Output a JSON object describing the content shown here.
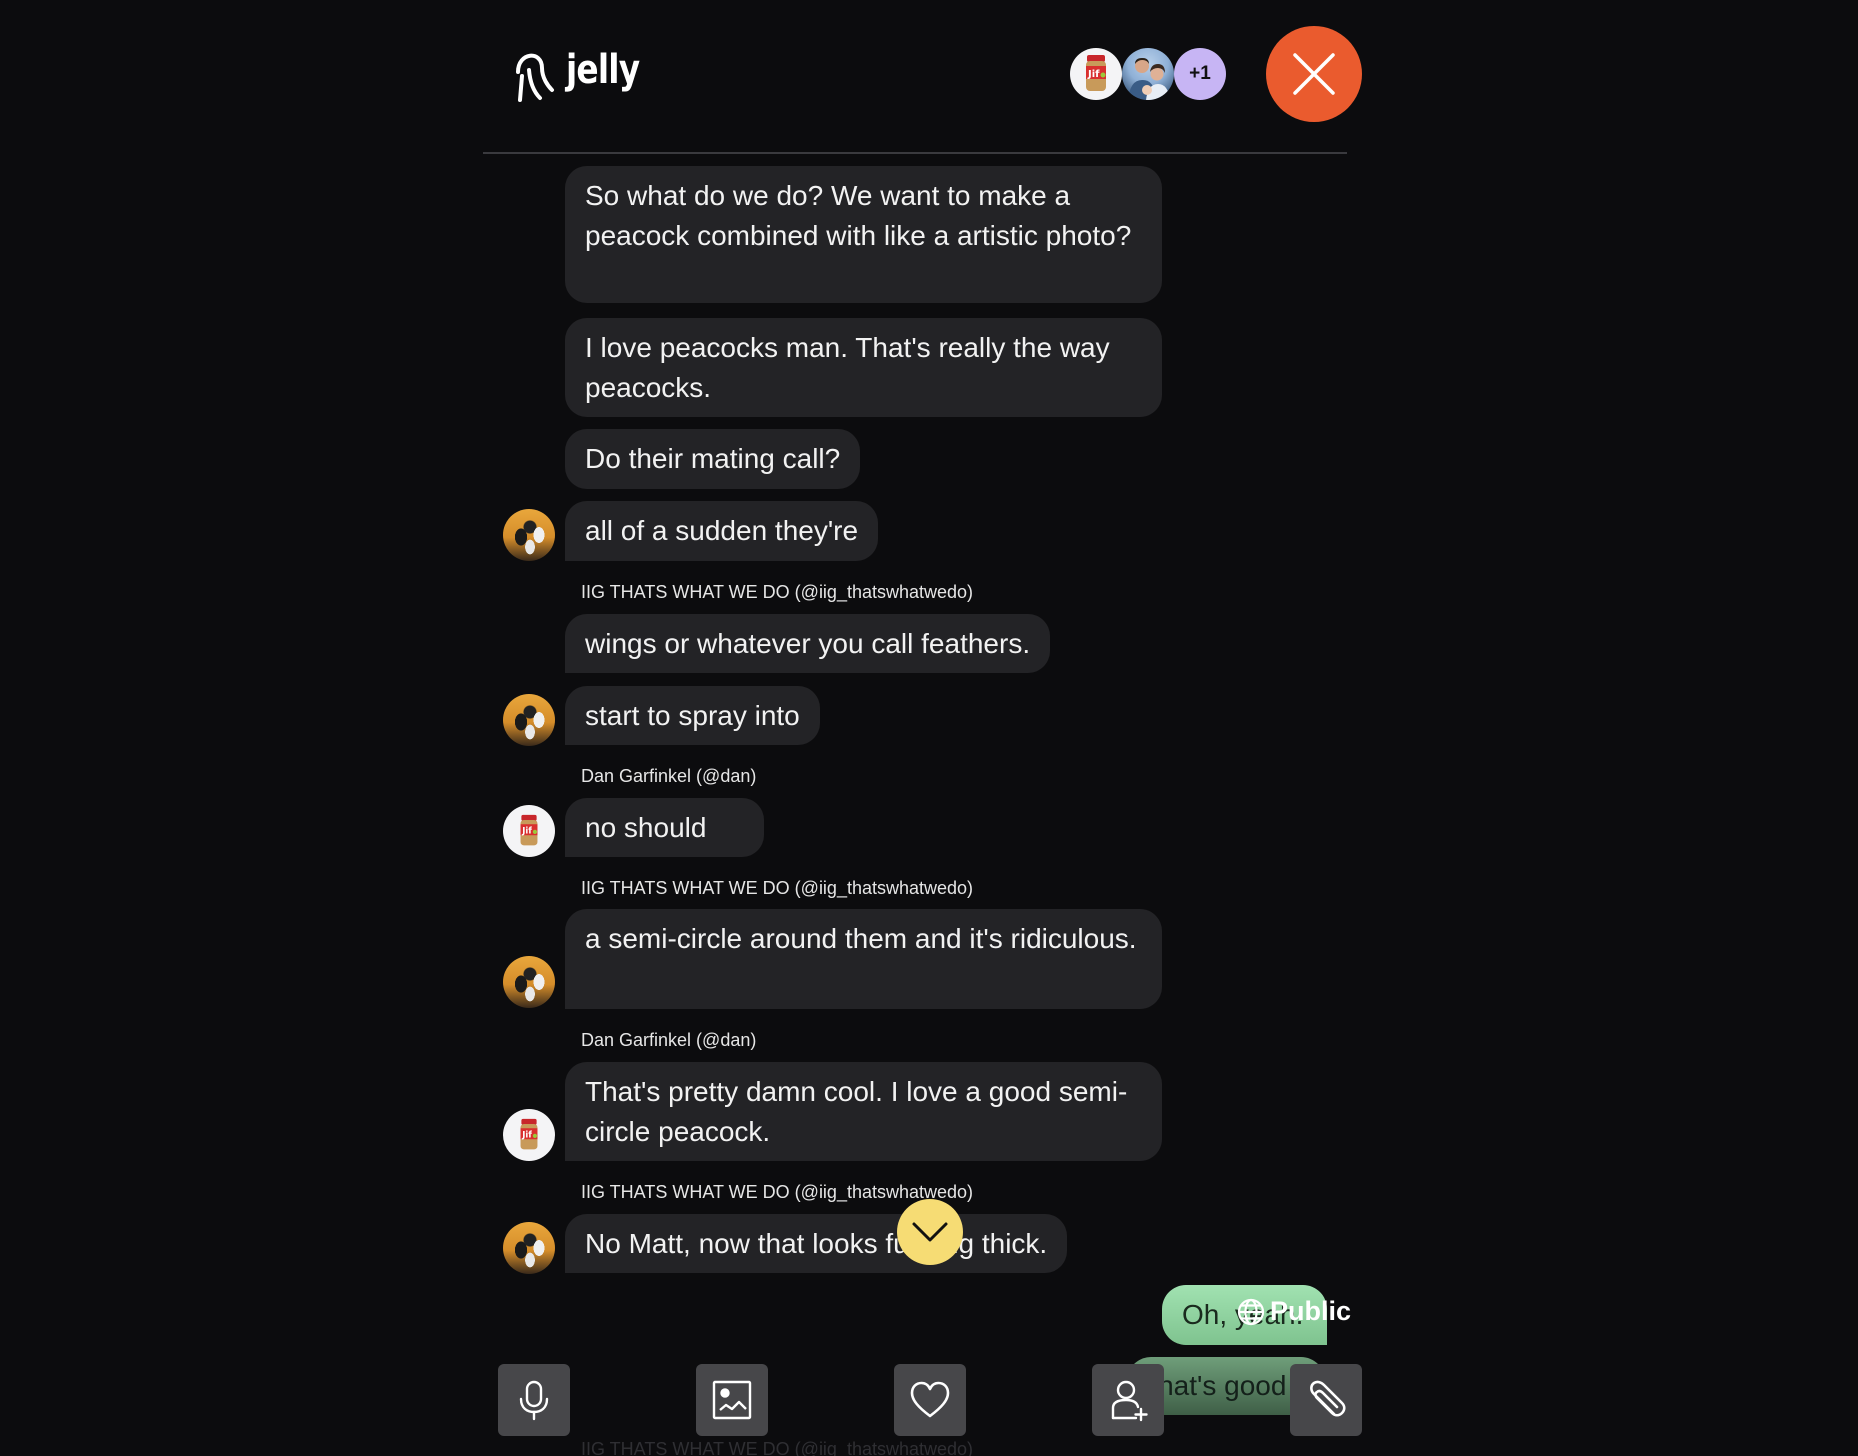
{
  "app": {
    "name": "jelly",
    "logo_icon": "jellyfish-icon"
  },
  "header": {
    "participants": [
      {
        "name": "Dan Garfinkel",
        "avatar": "jif-jar-avatar"
      },
      {
        "name": "family-photo",
        "avatar": "family-photo-avatar"
      }
    ],
    "more_count": "+1",
    "close_icon": "close-icon",
    "close_color": "#ea5b2e"
  },
  "messages": [
    {
      "text": "So what do we do? We want to make a peacock combined with like a artistic photo?"
    },
    {
      "text": "I love peacocks man. That's really the way peacocks."
    },
    {
      "text": "Do their mating call?"
    },
    {
      "text": "all of a sudden they're"
    },
    {
      "sender": "IIG THATS WHAT WE DO (@iig_thatswhatwedo)",
      "text": "wings or whatever you call feathers."
    },
    {
      "text": "start to spray into"
    },
    {
      "sender": "Dan Garfinkel (@dan)",
      "text": "no should"
    },
    {
      "sender": "IIG THATS WHAT WE DO (@iig_thatswhatwedo)",
      "text": "a semi-circle around them and it's ridiculous."
    },
    {
      "sender": "Dan Garfinkel (@dan)",
      "text": "That's pretty damn cool. I love a good semi-circle peacock."
    },
    {
      "sender": "IIG THATS WHAT WE DO (@iig_thatswhatwedo)",
      "text": "No Matt, now that looks fucking thick."
    }
  ],
  "outgoing": [
    {
      "text": "Oh, yeah."
    },
    {
      "text": "That's good"
    }
  ],
  "visibility": {
    "label": "Public",
    "icon": "globe-icon"
  },
  "scroll_down_color": "#f6dc74",
  "toolbar": {
    "buttons": [
      {
        "name": "microphone",
        "icon": "microphone-icon"
      },
      {
        "name": "image",
        "icon": "image-icon"
      },
      {
        "name": "heart",
        "icon": "heart-icon"
      },
      {
        "name": "add-person",
        "icon": "add-person-icon"
      },
      {
        "name": "attachment",
        "icon": "paperclip-icon"
      }
    ]
  },
  "next_sender_preview": "IIG THATS WHAT WE DO (@iig_thatswhatwedo)"
}
